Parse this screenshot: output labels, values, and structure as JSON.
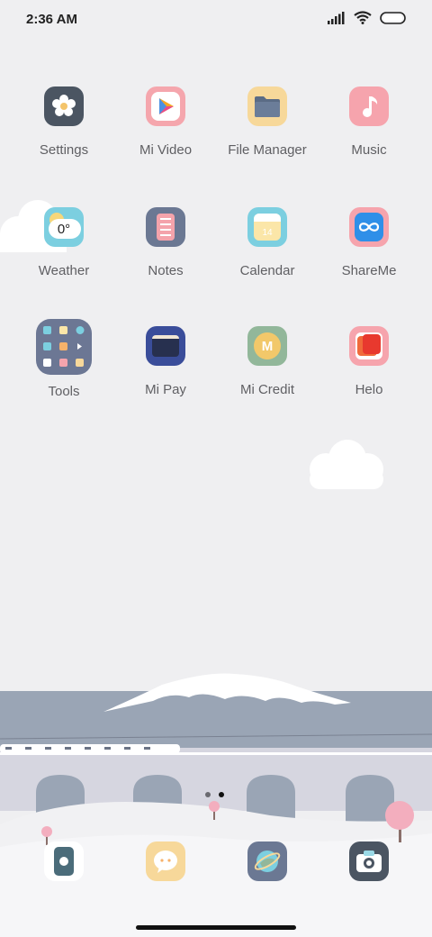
{
  "status": {
    "time": "2:36 AM"
  },
  "apps": [
    {
      "label": "Settings"
    },
    {
      "label": "Mi Video"
    },
    {
      "label": "File Manager"
    },
    {
      "label": "Music"
    },
    {
      "label": "Weather",
      "temp": "0°"
    },
    {
      "label": "Notes"
    },
    {
      "label": "Calendar",
      "day": "14"
    },
    {
      "label": "ShareMe"
    },
    {
      "label": "Tools"
    },
    {
      "label": "Mi Pay"
    },
    {
      "label": "Mi Credit"
    },
    {
      "label": "Helo"
    }
  ],
  "dock": [
    {
      "icon": "security-icon"
    },
    {
      "icon": "messages-icon"
    },
    {
      "icon": "browser-icon"
    },
    {
      "icon": "camera-icon"
    }
  ],
  "page_indicator": {
    "pages": 2,
    "current": 2
  },
  "colors": {
    "background": "#efeff1",
    "label": "#5f5f63",
    "mountain_sea": "#9aa5b5"
  }
}
